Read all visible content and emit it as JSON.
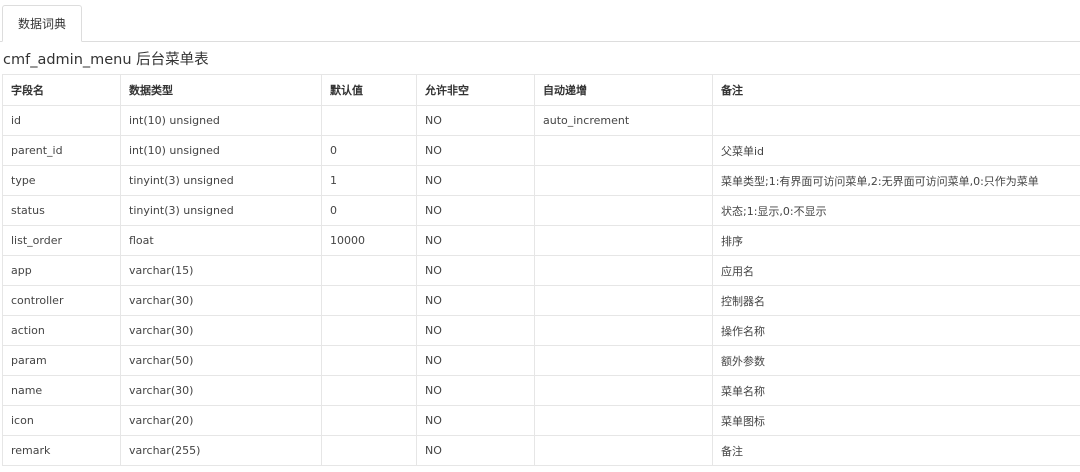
{
  "tabs": [
    {
      "label": "数据词典"
    }
  ],
  "table_title": "cmf_admin_menu 后台菜单表",
  "table": {
    "headers": [
      "字段名",
      "数据类型",
      "默认值",
      "允许非空",
      "自动递增",
      "备注"
    ],
    "rows": [
      [
        "id",
        "int(10) unsigned",
        "",
        "NO",
        "auto_increment",
        ""
      ],
      [
        "parent_id",
        "int(10) unsigned",
        "0",
        "NO",
        "",
        "父菜单id"
      ],
      [
        "type",
        "tinyint(3) unsigned",
        "1",
        "NO",
        "",
        "菜单类型;1:有界面可访问菜单,2:无界面可访问菜单,0:只作为菜单"
      ],
      [
        "status",
        "tinyint(3) unsigned",
        "0",
        "NO",
        "",
        "状态;1:显示,0:不显示"
      ],
      [
        "list_order",
        "float",
        "10000",
        "NO",
        "",
        "排序"
      ],
      [
        "app",
        "varchar(15)",
        "",
        "NO",
        "",
        "应用名"
      ],
      [
        "controller",
        "varchar(30)",
        "",
        "NO",
        "",
        "控制器名"
      ],
      [
        "action",
        "varchar(30)",
        "",
        "NO",
        "",
        "操作名称"
      ],
      [
        "param",
        "varchar(50)",
        "",
        "NO",
        "",
        "额外参数"
      ],
      [
        "name",
        "varchar(30)",
        "",
        "NO",
        "",
        "菜单名称"
      ],
      [
        "icon",
        "varchar(20)",
        "",
        "NO",
        "",
        "菜单图标"
      ],
      [
        "remark",
        "varchar(255)",
        "",
        "NO",
        "",
        "备注"
      ]
    ]
  }
}
